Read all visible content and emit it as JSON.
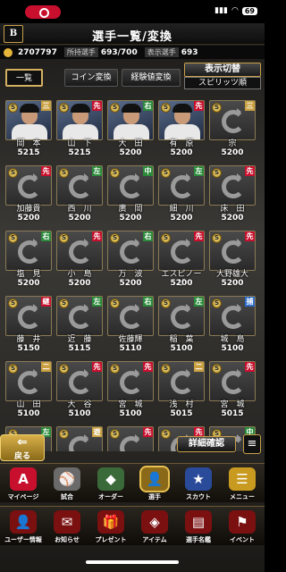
{
  "status": {
    "battery": "69",
    "signal_icon": "signal-icon",
    "wifi_icon": "wifi-icon"
  },
  "header": {
    "logo": "B",
    "title": "選手一覧/変換"
  },
  "stats": {
    "coins": "2707797",
    "owned_label": "所持選手",
    "owned_value": "693/700",
    "shown_label": "表示選手",
    "shown_value": "693"
  },
  "tabs": [
    {
      "label": "一覧",
      "active": true
    },
    {
      "label": "コイン変換",
      "active": false
    },
    {
      "label": "経験値変換",
      "active": false
    }
  ],
  "display": {
    "switch_label": "表示切替",
    "sort_label": "スピリッツ順"
  },
  "players": [
    {
      "name": "岡　本",
      "value": "5215",
      "rank": "S",
      "pos": "三",
      "pos_color": "#c9a040",
      "photo": true
    },
    {
      "name": "山　下",
      "value": "5215",
      "rank": "S",
      "pos": "先",
      "pos_color": "#c8102e",
      "photo": true
    },
    {
      "name": "大　田",
      "value": "5200",
      "rank": "S",
      "pos": "右",
      "pos_color": "#2a8a3a",
      "photo": true
    },
    {
      "name": "有　原",
      "value": "5200",
      "rank": "S",
      "pos": "先",
      "pos_color": "#c8102e",
      "photo": true
    },
    {
      "name": "宗",
      "value": "5200",
      "rank": "S",
      "pos": "三",
      "pos_color": "#c9a040",
      "photo": false
    },
    {
      "name": "加藤貴",
      "value": "5200",
      "rank": "S",
      "pos": "先",
      "pos_color": "#c8102e",
      "photo": false
    },
    {
      "name": "西　川",
      "value": "5200",
      "rank": "S",
      "pos": "左",
      "pos_color": "#2a8a3a",
      "photo": false
    },
    {
      "name": "廣　岡",
      "value": "5200",
      "rank": "S",
      "pos": "中",
      "pos_color": "#2a8a3a",
      "photo": false
    },
    {
      "name": "細　川",
      "value": "5200",
      "rank": "S",
      "pos": "左",
      "pos_color": "#2a8a3a",
      "photo": false
    },
    {
      "name": "床　田",
      "value": "5200",
      "rank": "S",
      "pos": "先",
      "pos_color": "#c8102e",
      "photo": false
    },
    {
      "name": "塩　見",
      "value": "5200",
      "rank": "S",
      "pos": "右",
      "pos_color": "#2a8a3a",
      "photo": false
    },
    {
      "name": "小　島",
      "value": "5200",
      "rank": "S",
      "pos": "先",
      "pos_color": "#c8102e",
      "photo": false
    },
    {
      "name": "万　波",
      "value": "5200",
      "rank": "S",
      "pos": "右",
      "pos_color": "#2a8a3a",
      "photo": false
    },
    {
      "name": "エスピノーザ",
      "value": "5200",
      "rank": "S",
      "pos": "先",
      "pos_color": "#c8102e",
      "photo": false
    },
    {
      "name": "大野雄大",
      "value": "5200",
      "rank": "S",
      "pos": "先",
      "pos_color": "#c8102e",
      "photo": false
    },
    {
      "name": "藤　井",
      "value": "5150",
      "rank": "S",
      "pos": "継",
      "pos_color": "#c8102e",
      "photo": false
    },
    {
      "name": "近　藤",
      "value": "5115",
      "rank": "S",
      "pos": "左",
      "pos_color": "#2a8a3a",
      "photo": false
    },
    {
      "name": "佐藤輝",
      "value": "5110",
      "rank": "S",
      "pos": "右",
      "pos_color": "#2a8a3a",
      "photo": false
    },
    {
      "name": "稲　葉",
      "value": "5100",
      "rank": "S",
      "pos": "左",
      "pos_color": "#2a8a3a",
      "photo": false
    },
    {
      "name": "城　島",
      "value": "5100",
      "rank": "S",
      "pos": "捕",
      "pos_color": "#2a6ac8",
      "photo": false
    },
    {
      "name": "山　田",
      "value": "5100",
      "rank": "S",
      "pos": "二",
      "pos_color": "#c9a040",
      "photo": false
    },
    {
      "name": "大　谷",
      "value": "5100",
      "rank": "S",
      "pos": "先",
      "pos_color": "#c8102e",
      "photo": false
    },
    {
      "name": "宮　城",
      "value": "5100",
      "rank": "S",
      "pos": "先",
      "pos_color": "#c8102e",
      "photo": false
    },
    {
      "name": "浅　村",
      "value": "5015",
      "rank": "S",
      "pos": "二",
      "pos_color": "#c9a040",
      "photo": false
    },
    {
      "name": "宮　城",
      "value": "5015",
      "rank": "S",
      "pos": "先",
      "pos_color": "#c8102e",
      "photo": false
    },
    {
      "name": "",
      "value": "",
      "rank": "S",
      "pos": "左",
      "pos_color": "#2a8a3a",
      "photo": false
    },
    {
      "name": "",
      "value": "",
      "rank": "S",
      "pos": "遊",
      "pos_color": "#c9a040",
      "photo": false
    },
    {
      "name": "",
      "value": "",
      "rank": "S",
      "pos": "先",
      "pos_color": "#c8102e",
      "photo": false
    },
    {
      "name": "",
      "value": "",
      "rank": "S",
      "pos": "先",
      "pos_color": "#c8102e",
      "photo": false
    },
    {
      "name": "",
      "value": "",
      "rank": "S",
      "pos": "中",
      "pos_color": "#2a8a3a",
      "photo": false
    }
  ],
  "actions": {
    "back_label": "戻る",
    "detail_label": "詳細確認",
    "menu_icon": "bars-icon"
  },
  "nav_main": [
    {
      "label": "マイページ",
      "icon": "A",
      "color": "#c8102e",
      "active": false
    },
    {
      "label": "試合",
      "icon": "⚾",
      "color": "#6a6a6a",
      "active": false
    },
    {
      "label": "オーダー",
      "icon": "◆",
      "color": "#3a6a3a",
      "active": false
    },
    {
      "label": "選手",
      "icon": "👤",
      "color": "#8a6a18",
      "active": true
    },
    {
      "label": "スカウト",
      "icon": "★",
      "color": "#2a4a9a",
      "active": false
    },
    {
      "label": "メニュー",
      "icon": "☰",
      "color": "#c89a20",
      "active": false
    }
  ],
  "nav_sub": [
    {
      "label": "ユーザー情報",
      "icon": "👤",
      "color": "#7a1010"
    },
    {
      "label": "お知らせ",
      "icon": "✉",
      "color": "#7a1010"
    },
    {
      "label": "プレゼント",
      "icon": "🎁",
      "color": "#7a1010"
    },
    {
      "label": "アイテム",
      "icon": "◈",
      "color": "#7a1010"
    },
    {
      "label": "選手名鑑",
      "icon": "▤",
      "color": "#7a1010"
    },
    {
      "label": "イベント",
      "icon": "⚑",
      "color": "#7a1010"
    }
  ]
}
